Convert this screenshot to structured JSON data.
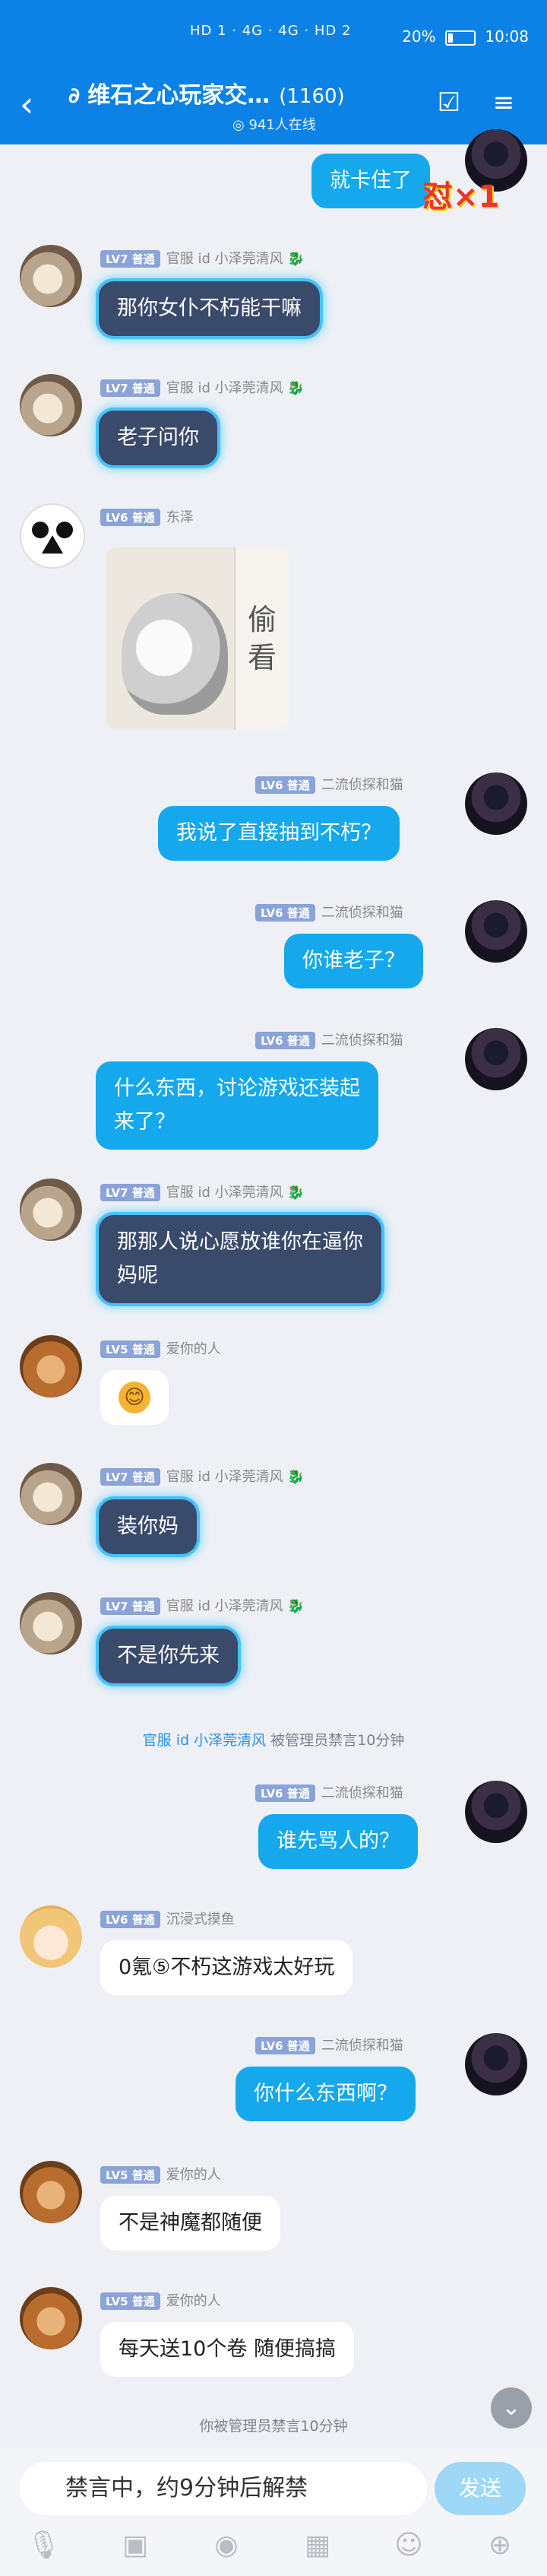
{
  "status_bar": {
    "left": "HD 1 · 4G · 4G · HD 2",
    "battery": "20%",
    "time": "10:08"
  },
  "header": {
    "title": "维石之心玩家交…",
    "count": "(1160)",
    "online": "941人在线"
  },
  "messages": [
    {
      "side": "right",
      "text": "就卡住了"
    },
    {
      "side": "left",
      "lv": "LV7 普通",
      "name": "官服 id 小泽莞清风",
      "text": "那你女仆不朽能干嘛"
    },
    {
      "side": "left",
      "lv": "LV7 普通",
      "name": "官服 id 小泽莞清风",
      "text": "老子问你"
    },
    {
      "side": "left",
      "lv": "LV6 普通",
      "name": "东泽",
      "sticker_text": "偷看"
    },
    {
      "side": "right",
      "lv": "LV6 普通",
      "name": "二流侦探和猫",
      "text": "我说了直接抽到不朽？"
    },
    {
      "side": "right",
      "lv": "LV6 普通",
      "name": "二流侦探和猫",
      "text": "你谁老子？"
    },
    {
      "side": "right",
      "lv": "LV6 普通",
      "name": "二流侦探和猫",
      "text_line1": "什么东西，讨论游戏还装起",
      "text_line2": "来了？"
    },
    {
      "side": "left",
      "lv": "LV7 普通",
      "name": "官服 id 小泽莞清风",
      "text_line1": "那那人说心愿放谁你在逼你",
      "text_line2": "妈呢"
    },
    {
      "side": "left",
      "lv": "LV5 普通",
      "name": "爱你的人",
      "text": "😊"
    },
    {
      "side": "left",
      "lv": "LV7 普通",
      "name": "官服 id 小泽莞清风",
      "text": "装你妈"
    },
    {
      "side": "left",
      "lv": "LV7 普通",
      "name": "官服 id 小泽莞清风",
      "text": "不是你先来"
    },
    {
      "side": "right",
      "lv": "LV6 普通",
      "name": "二流侦探和猫",
      "text": "谁先骂人的？"
    },
    {
      "side": "left",
      "lv": "LV6 普通",
      "name": "沉浸式摸鱼",
      "text": "0氪⑤不朽这游戏太好玩"
    },
    {
      "side": "right",
      "lv": "LV6 普通",
      "name": "二流侦探和猫",
      "text": "你什么东西啊？"
    },
    {
      "side": "left",
      "lv": "LV5 普通",
      "name": "爱你的人",
      "text": "不是神魔都随便"
    },
    {
      "side": "left",
      "lv": "LV5 普通",
      "name": "爱你的人",
      "text": "每天送10个卷 随便搞搞"
    }
  ],
  "system_notices": {
    "ban1_prefix": "官服 id 小泽莞清风",
    "ban1_suffix": " 被管理员禁言10分钟",
    "ban2": "你被管理员禁言10分钟"
  },
  "badge": "怼×1",
  "input": {
    "placeholder": "禁言中，约9分钟后解禁",
    "send_label": "发送"
  },
  "toolbar_icons": [
    "mic-icon",
    "image-icon",
    "camera-icon",
    "gift-icon",
    "emoji-icon",
    "plus-icon"
  ]
}
